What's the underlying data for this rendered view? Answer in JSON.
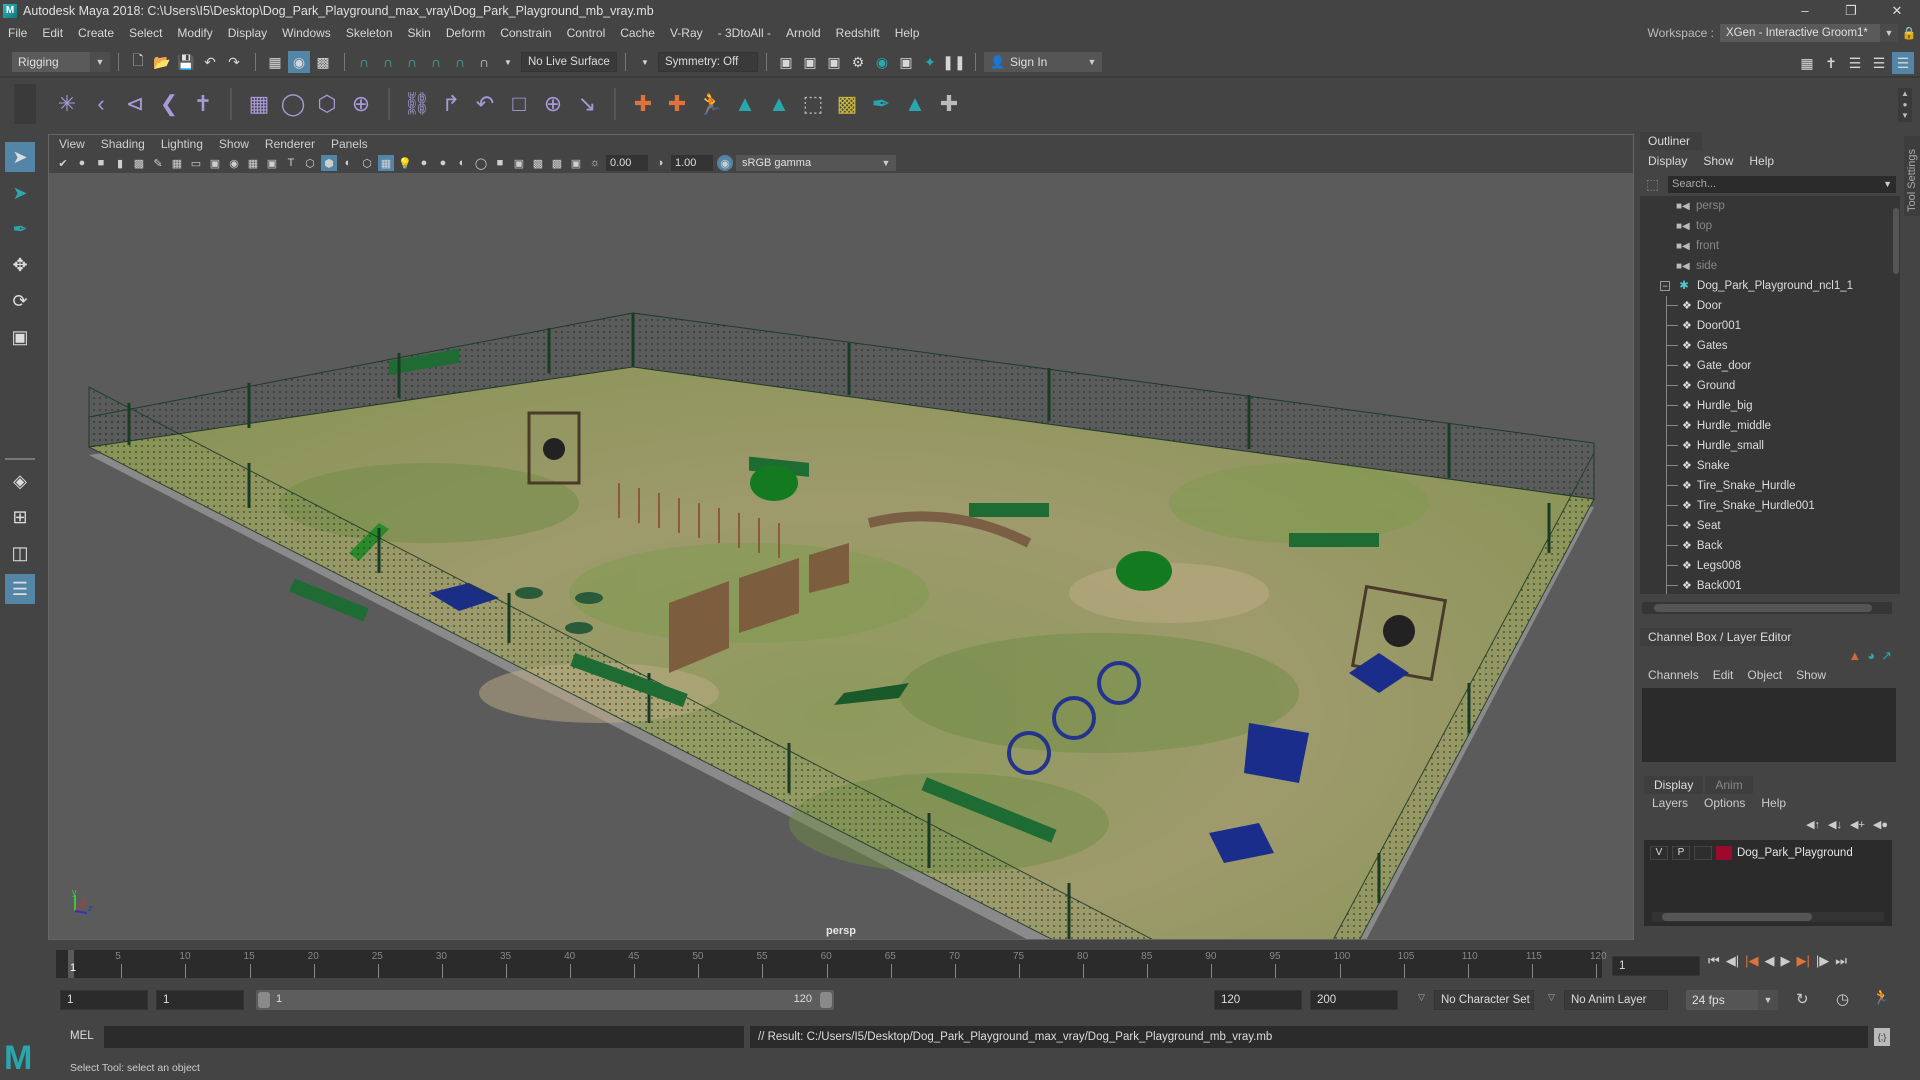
{
  "window": {
    "title": "Autodesk Maya 2018: C:\\Users\\I5\\Desktop\\Dog_Park_Playground_max_vray\\Dog_Park_Playground_mb_vray.mb",
    "logo": "M",
    "controls": [
      "minimize-icon",
      "restore-icon",
      "close-icon"
    ]
  },
  "menubar": {
    "items": [
      "File",
      "Edit",
      "Create",
      "Select",
      "Modify",
      "Display",
      "Windows",
      "Skeleton",
      "Skin",
      "Deform",
      "Constrain",
      "Control",
      "Cache",
      "V-Ray",
      "- 3DtoAll -",
      "Arnold",
      "Redshift",
      "Help"
    ],
    "workspace_label": "Workspace :",
    "workspace_value": "XGen - Interactive Groom1*"
  },
  "statusline": {
    "menuset": "Rigging",
    "live_surface": "No Live Surface",
    "symmetry": "Symmetry: Off",
    "sign_in": "Sign In"
  },
  "viewport": {
    "menu": [
      "View",
      "Shading",
      "Lighting",
      "Show",
      "Renderer",
      "Panels"
    ],
    "exposure": "0.00",
    "gamma": "1.00",
    "color_space": "sRGB gamma",
    "camera_label": "persp",
    "axis": {
      "x": "x",
      "y": "y",
      "z": "z"
    }
  },
  "outliner": {
    "title": "Outliner",
    "menu": [
      "Display",
      "Show",
      "Help"
    ],
    "search_placeholder": "Search...",
    "cameras": [
      "persp",
      "top",
      "front",
      "side"
    ],
    "group": "Dog_Park_Playground_ncl1_1",
    "children": [
      "Door",
      "Door001",
      "Gates",
      "Gate_door",
      "Ground",
      "Hurdle_big",
      "Hurdle_middle",
      "Hurdle_small",
      "Snake",
      "Tire_Snake_Hurdle",
      "Tire_Snake_Hurdle001",
      "Seat",
      "Back",
      "Legs008",
      "Back001"
    ]
  },
  "tool_settings_tab": "Tool Settings",
  "channelbox": {
    "title": "Channel Box / Layer Editor",
    "menu": [
      "Channels",
      "Edit",
      "Object",
      "Show"
    ]
  },
  "layereditor": {
    "tabs": [
      "Display",
      "Anim"
    ],
    "menu": [
      "Layers",
      "Options",
      "Help"
    ],
    "layers": [
      {
        "v": "V",
        "p": "P",
        "color": "#9b0a2a",
        "name": "Dog_Park_Playground"
      }
    ]
  },
  "timeline": {
    "ticks": [
      "5",
      "10",
      "15",
      "20",
      "25",
      "30",
      "35",
      "40",
      "45",
      "50",
      "55",
      "60",
      "65",
      "70",
      "75",
      "80",
      "85",
      "90",
      "95",
      "100",
      "105",
      "110",
      "115",
      "120"
    ],
    "current_marker": "1",
    "current_frame": "1",
    "start_frame": "1",
    "playback_start": "1",
    "range_start": "1",
    "range_end": "120",
    "playback_end": "120",
    "end_frame": "200",
    "character_set": "No Character Set",
    "anim_layer": "No Anim Layer",
    "fps": "24 fps"
  },
  "commandline": {
    "language": "MEL",
    "result": "// Result: C:/Users/I5/Desktop/Dog_Park_Playground_max_vray/Dog_Park_Playground_mb_vray.mb"
  },
  "helpline": {
    "text": "Select Tool: select an object"
  },
  "colors": {
    "accent": "#5285a6",
    "maya_teal": "#2aa6ad",
    "layer_red": "#9b0a2a"
  }
}
